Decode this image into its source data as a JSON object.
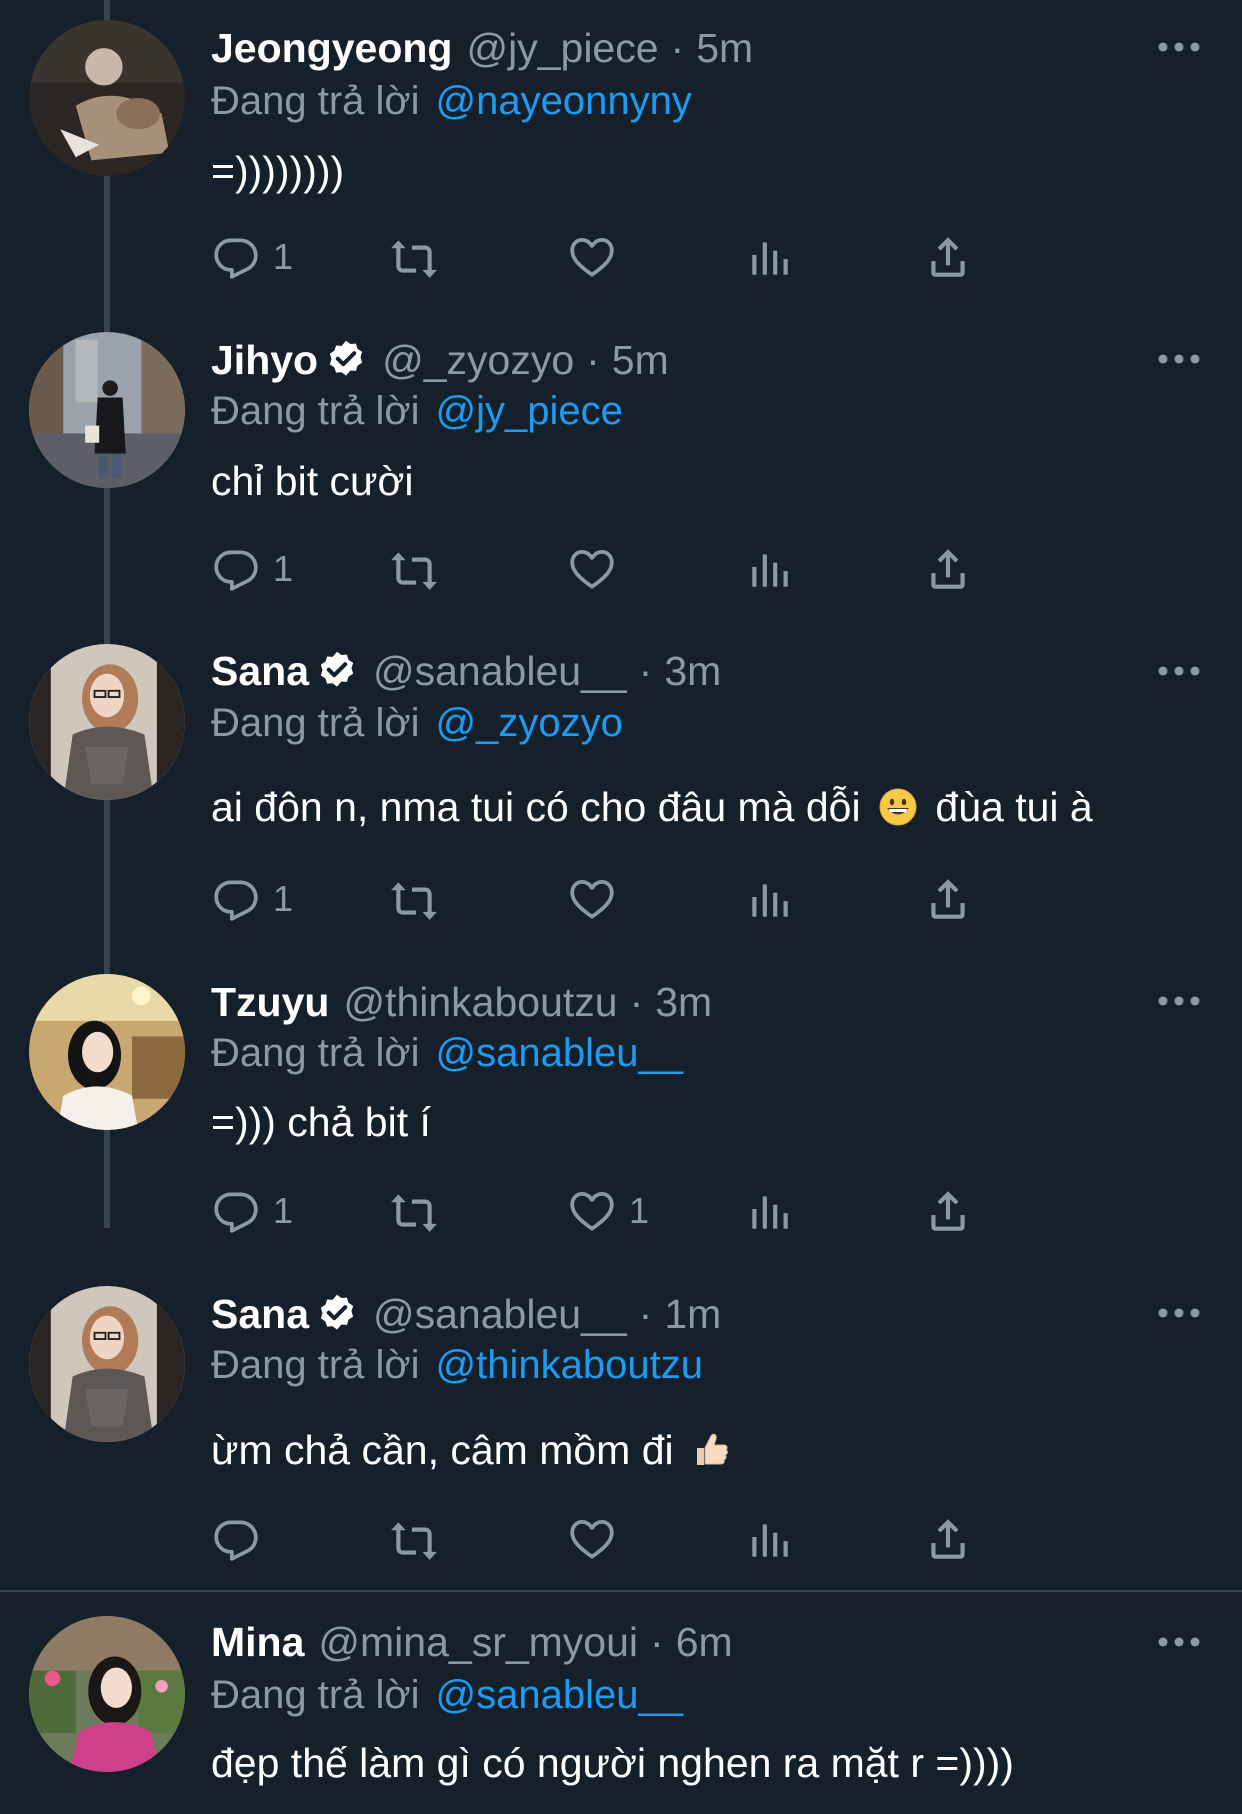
{
  "reply_prefix": "Đang trả lời",
  "tweets": [
    {
      "name": "Jeongyeong",
      "verified": false,
      "handle": "@jy_piece",
      "time": "5m",
      "reply_to": "@nayeonnyny",
      "text": "=))))))))",
      "reply_count": "1",
      "like_count": ""
    },
    {
      "name": "Jihyo",
      "verified": true,
      "handle": "@_zyozyo",
      "time": "5m",
      "reply_to": "@jy_piece",
      "text": "chỉ bit cười",
      "reply_count": "1",
      "like_count": ""
    },
    {
      "name": "Sana",
      "verified": true,
      "handle": "@sanableu__",
      "time": "3m",
      "reply_to": "@_zyozyo",
      "text_before": "ai đôn n, nma tui có cho đâu mà dỗi",
      "emoji": "grinning-face",
      "text_after": "đùa tui à",
      "reply_count": "1",
      "like_count": ""
    },
    {
      "name": "Tzuyu",
      "verified": false,
      "handle": "@thinkaboutzu",
      "time": "3m",
      "reply_to": "@sanableu__",
      "text": "=))) chả bit í",
      "reply_count": "1",
      "like_count": "1"
    },
    {
      "name": "Sana",
      "verified": true,
      "handle": "@sanableu__",
      "time": "1m",
      "reply_to": "@thinkaboutzu",
      "text_before": "ừm chả cần, câm mồm đi",
      "emoji": "thumbs-up",
      "reply_count": "",
      "like_count": ""
    },
    {
      "name": "Mina",
      "verified": false,
      "handle": "@mina_sr_myoui",
      "time": "6m",
      "reply_to": "@sanableu__",
      "text": "đẹp thế làm gì có người nghen ra mặt r =))))"
    }
  ],
  "separator": "·",
  "colors": {
    "background": "#15202b",
    "secondary_text": "#8b98a5",
    "link": "#1d9bf0",
    "thread_line": "#38444d"
  }
}
